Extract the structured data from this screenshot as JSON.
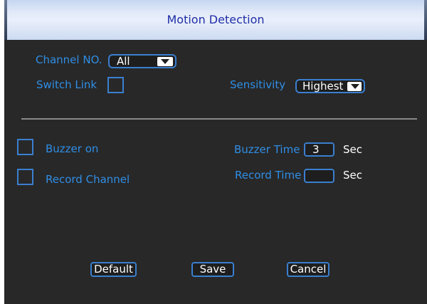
{
  "window": {
    "title": "Motion Detection"
  },
  "channel": {
    "label": "Channel NO.",
    "value": "All"
  },
  "switch_link": {
    "label": "Switch Link",
    "checked": false
  },
  "sensitivity": {
    "label": "Sensitivity",
    "value": "Highest"
  },
  "buzzer": {
    "label": "Buzzer on",
    "checked": false
  },
  "buzzer_time": {
    "label": "Buzzer Time",
    "value": "3",
    "unit": "Sec"
  },
  "record_channel": {
    "label": "Record Channel",
    "checked": false
  },
  "record_time": {
    "label": "Record Time",
    "value": "",
    "unit": "Sec"
  },
  "buttons": {
    "default": "Default",
    "save": "Save",
    "cancel": "Cancel"
  },
  "colors": {
    "label_blue": "#2f8ee6",
    "border_blue": "#3a7fd0",
    "panel_bg": "#282828",
    "title_text": "#1f2da8"
  }
}
